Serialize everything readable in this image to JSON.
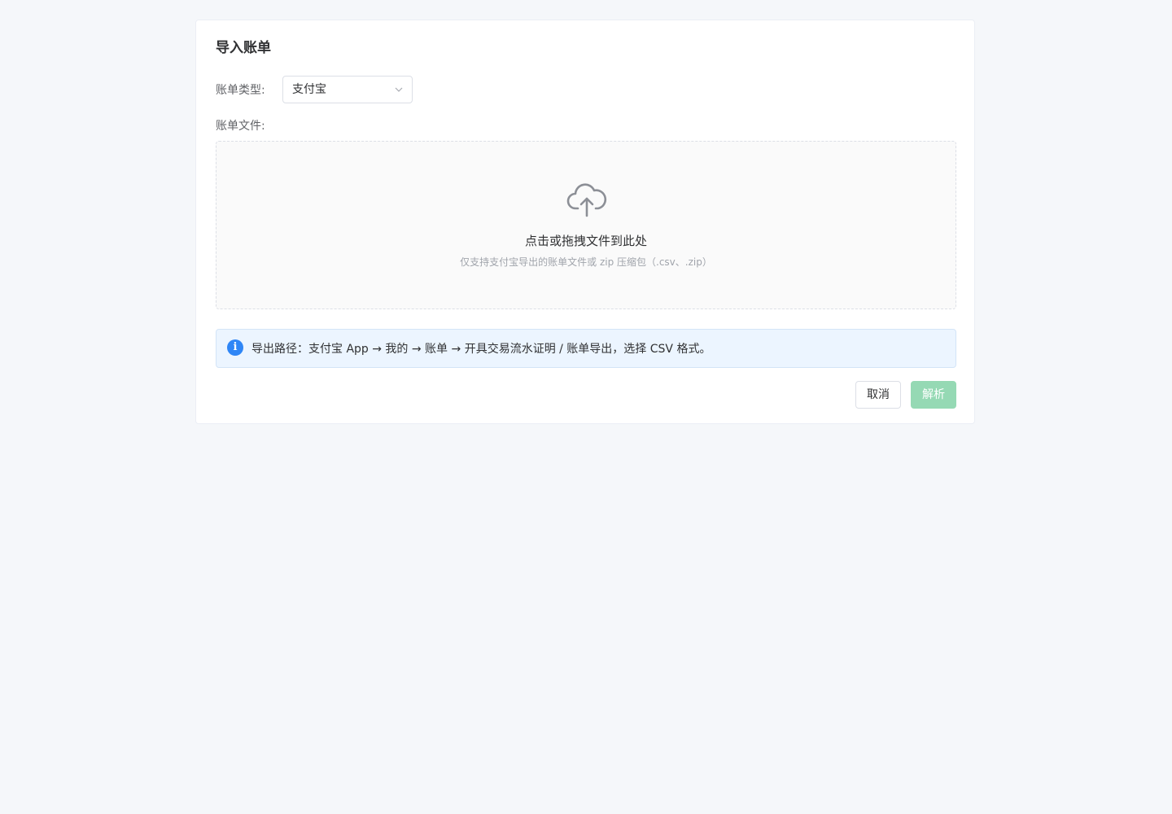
{
  "dialog": {
    "title": "导入账单"
  },
  "form": {
    "type_label": "账单类型:",
    "type_value": "支付宝",
    "file_label": "账单文件:"
  },
  "upload": {
    "icon": "cloud-upload-icon",
    "main_text": "点击或拖拽文件到此处",
    "sub_text": "仅支持支付宝导出的账单文件或 zip 压缩包（.csv、.zip）"
  },
  "alert": {
    "icon": "info-icon",
    "icon_glyph": "i",
    "text": "导出路径：支付宝 App → 我的 → 账单 → 开具交易流水证明 / 账单导出，选择 CSV 格式。"
  },
  "actions": {
    "cancel_label": "取消",
    "parse_label": "解析"
  },
  "colors": {
    "primary_disabled": "#95d9b4",
    "info": "#2f86f6",
    "alert_bg": "#ecf5ff"
  }
}
